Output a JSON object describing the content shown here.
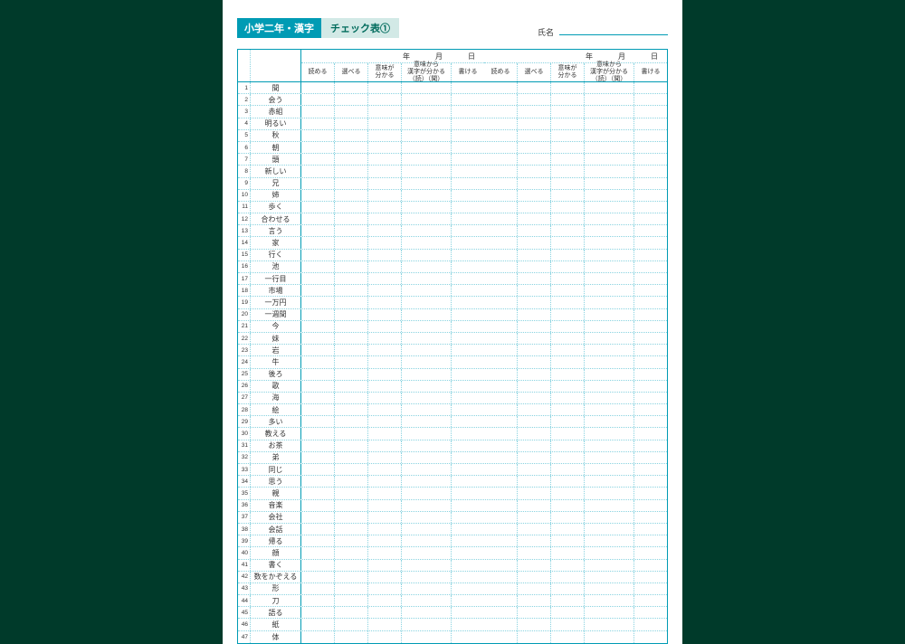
{
  "header": {
    "title": "小学二年・漢字",
    "subtitle": "チェック表①",
    "name_label": "氏名"
  },
  "date_units": {
    "year": "年",
    "month": "月",
    "day": "日"
  },
  "columns": [
    {
      "label": "読める",
      "wide": false
    },
    {
      "label": "選べる",
      "wide": false
    },
    {
      "label": "意味が\n分かる",
      "wide": false
    },
    {
      "label": "意味から\n漢字が分かる\n（読）（聞）",
      "wide": true
    },
    {
      "label": "書ける",
      "wide": false
    }
  ],
  "rows": [
    {
      "n": 1,
      "w": "間"
    },
    {
      "n": 2,
      "w": "会う"
    },
    {
      "n": 3,
      "w": "赤組"
    },
    {
      "n": 4,
      "w": "明るい"
    },
    {
      "n": 5,
      "w": "秋"
    },
    {
      "n": 6,
      "w": "朝"
    },
    {
      "n": 7,
      "w": "頭"
    },
    {
      "n": 8,
      "w": "新しい"
    },
    {
      "n": 9,
      "w": "兄"
    },
    {
      "n": 10,
      "w": "姉"
    },
    {
      "n": 11,
      "w": "歩く"
    },
    {
      "n": 12,
      "w": "合わせる"
    },
    {
      "n": 13,
      "w": "言う"
    },
    {
      "n": 14,
      "w": "家"
    },
    {
      "n": 15,
      "w": "行く"
    },
    {
      "n": 16,
      "w": "池"
    },
    {
      "n": 17,
      "w": "一行目"
    },
    {
      "n": 18,
      "w": "市場"
    },
    {
      "n": 19,
      "w": "一万円"
    },
    {
      "n": 20,
      "w": "一週間"
    },
    {
      "n": 21,
      "w": "今"
    },
    {
      "n": 22,
      "w": "妹"
    },
    {
      "n": 23,
      "w": "岩"
    },
    {
      "n": 24,
      "w": "牛"
    },
    {
      "n": 25,
      "w": "後ろ"
    },
    {
      "n": 26,
      "w": "歌"
    },
    {
      "n": 27,
      "w": "海"
    },
    {
      "n": 28,
      "w": "絵"
    },
    {
      "n": 29,
      "w": "多い"
    },
    {
      "n": 30,
      "w": "教える"
    },
    {
      "n": 31,
      "w": "お茶"
    },
    {
      "n": 32,
      "w": "弟"
    },
    {
      "n": 33,
      "w": "同じ"
    },
    {
      "n": 34,
      "w": "思う"
    },
    {
      "n": 35,
      "w": "親"
    },
    {
      "n": 36,
      "w": "音楽"
    },
    {
      "n": 37,
      "w": "会社"
    },
    {
      "n": 38,
      "w": "会話"
    },
    {
      "n": 39,
      "w": "帰る"
    },
    {
      "n": 40,
      "w": "顔"
    },
    {
      "n": 41,
      "w": "書く"
    },
    {
      "n": 42,
      "w": "数をかぞえる"
    },
    {
      "n": 43,
      "w": "形"
    },
    {
      "n": 44,
      "w": "刀"
    },
    {
      "n": 45,
      "w": "語る"
    },
    {
      "n": 46,
      "w": "紙"
    },
    {
      "n": 47,
      "w": "体"
    }
  ]
}
